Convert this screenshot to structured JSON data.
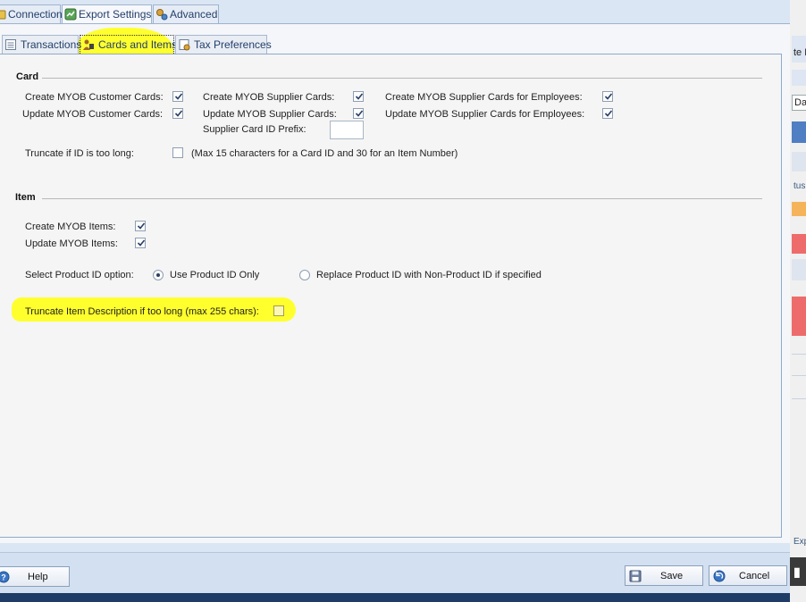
{
  "top_tabs": [
    {
      "label": "Connection",
      "icon": "connection-icon"
    },
    {
      "label": "Export Settings",
      "icon": "export-settings-icon"
    },
    {
      "label": "Advanced",
      "icon": "advanced-gears-icon"
    }
  ],
  "sub_tabs": [
    {
      "label": "Transactions",
      "icon": "transactions-icon"
    },
    {
      "label": "Cards and Items",
      "icon": "cards-items-icon"
    },
    {
      "label": "Tax Preferences",
      "icon": "tax-preferences-icon"
    }
  ],
  "card_section": {
    "title": "Card",
    "create_customer": {
      "label": "Create MYOB Customer Cards:",
      "checked": true
    },
    "update_customer": {
      "label": "Update MYOB Customer Cards:",
      "checked": true
    },
    "create_supplier": {
      "label": "Create MYOB Supplier Cards:",
      "checked": true
    },
    "update_supplier": {
      "label": "Update MYOB Supplier Cards:",
      "checked": true
    },
    "create_supplier_employees": {
      "label": "Create MYOB Supplier Cards for Employees:",
      "checked": true
    },
    "update_supplier_employees": {
      "label": "Update MYOB Supplier Cards for Employees:",
      "checked": true
    },
    "supplier_prefix": {
      "label": "Supplier Card ID Prefix:",
      "value": ""
    },
    "truncate_id": {
      "label": "Truncate if ID is too long:",
      "checked": false,
      "note": "(Max 15 characters for a Card ID and 30 for an Item Number)"
    }
  },
  "item_section": {
    "title": "Item",
    "create_items": {
      "label": "Create MYOB Items:",
      "checked": true
    },
    "update_items": {
      "label": "Update MYOB Items:",
      "checked": true
    },
    "product_id_option": {
      "label": "Select Product ID option:",
      "options": [
        "Use Product ID Only",
        "Replace Product ID with Non-Product ID if specified"
      ],
      "selected": "Use Product ID Only"
    },
    "truncate_description": {
      "label": "Truncate Item Description if too long (max 255 chars):",
      "checked": false
    }
  },
  "buttons": {
    "help": "Help",
    "save": "Save",
    "cancel": "Cancel"
  },
  "background_window": {
    "edge_text_1": "te L",
    "edge_field": "Da",
    "edge_text_2": "tus",
    "edge_text_3": "Exp"
  },
  "colors": {
    "highlight": "#ffff2e",
    "accent": "#233e6b",
    "background_orange": "#f6b45a",
    "background_red": "#ee6b6b"
  }
}
